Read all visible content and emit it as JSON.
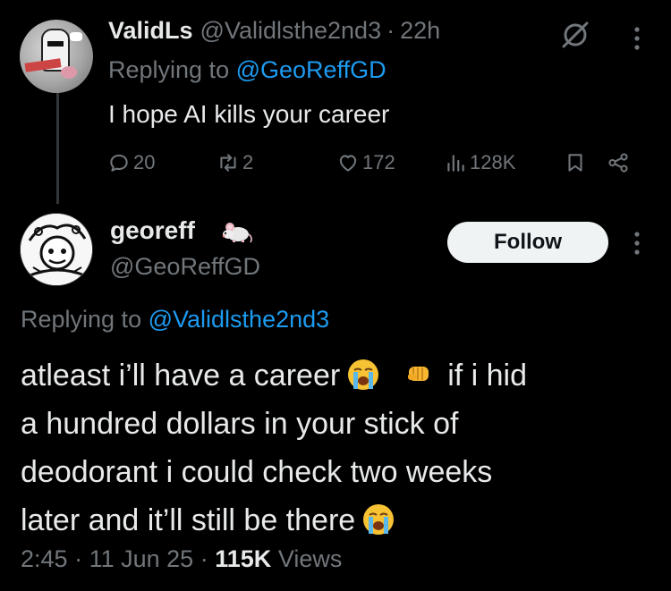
{
  "parent_tweet": {
    "display_name": "ValidLs",
    "handle": "@Validlsthe2nd3",
    "separator": "·",
    "time": "22h",
    "replying_prefix": "Replying to",
    "replying_to": "@GeoReffGD",
    "text": "I hope AI kills your career",
    "stats": {
      "replies": "20",
      "reposts": "2",
      "likes": "172",
      "views": "128K"
    },
    "icons": [
      "grok-icon",
      "more-icon",
      "reply-icon",
      "repost-icon",
      "like-icon",
      "views-icon",
      "bookmark-icon",
      "share-icon"
    ]
  },
  "reply_tweet": {
    "display_name": "georeff",
    "badge_icon": "mouse-emoji",
    "handle": "@GeoReffGD",
    "follow_label": "Follow",
    "replying_prefix": "Replying to",
    "replying_to": "@Validlsthe2nd3",
    "text_lines": [
      "atleast i’ll have a career",
      "if i hid",
      "a hundred dollars in your stick of",
      "deodorant i could check two weeks",
      "later and it’ll still be there"
    ],
    "emojis": [
      "loudly-crying-face",
      "oncoming-fist",
      "loudly-crying-face"
    ],
    "time": "2:45",
    "separator": "·",
    "date": "11 Jun 25",
    "views_count": "115K",
    "views_label": "Views"
  },
  "colors": {
    "background": "#000000",
    "text": "#e7e9ea",
    "muted": "#71767b",
    "link": "#1d9bf0",
    "follow_bg": "#eff3f4"
  }
}
